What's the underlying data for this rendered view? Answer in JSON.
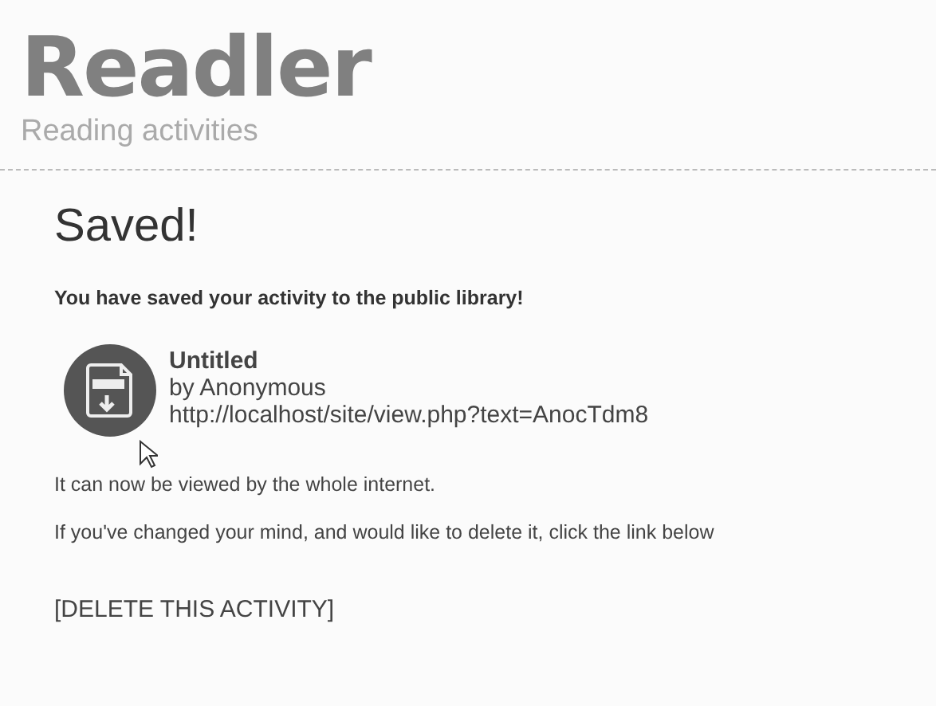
{
  "header": {
    "logo": "Readler",
    "tagline": "Reading activities"
  },
  "content": {
    "heading": "Saved!",
    "message": "You have saved your activity to the public library!",
    "activity": {
      "title": "Untitled",
      "author": "by Anonymous",
      "url": "http://localhost/site/view.php?text=AnocTdm8"
    },
    "notes": [
      "It can now be viewed by the whole internet.",
      "If you've changed your mind, and would like to delete it, click the link below"
    ],
    "delete_link": "[DELETE THIS ACTIVITY]"
  }
}
